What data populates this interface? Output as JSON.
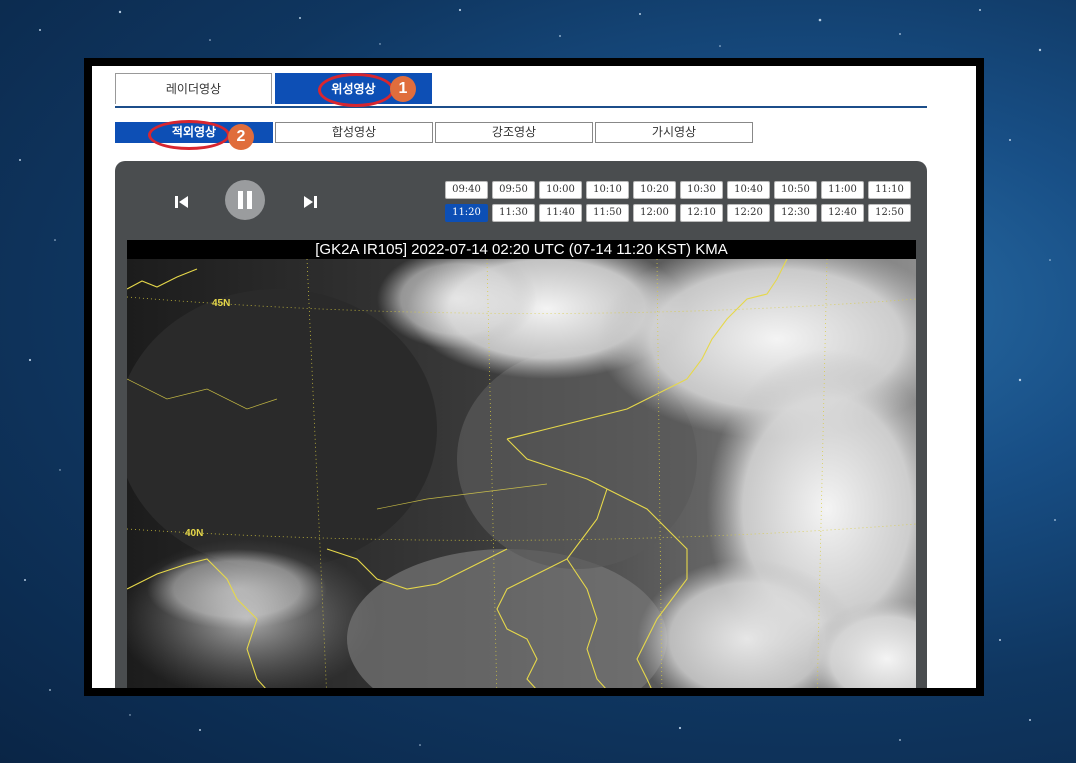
{
  "main_tabs": [
    {
      "label": "레이더영상",
      "active": false
    },
    {
      "label": "위성영상",
      "active": true
    }
  ],
  "sub_tabs": [
    {
      "label": "적외영상",
      "active": true
    },
    {
      "label": "합성영상",
      "active": false
    },
    {
      "label": "강조영상",
      "active": false
    },
    {
      "label": "가시영상",
      "active": false
    }
  ],
  "annotations": {
    "badge1": "1",
    "badge2": "2"
  },
  "player": {
    "prev_icon": "skip-back-icon",
    "pause_icon": "pause-icon",
    "next_icon": "skip-forward-icon",
    "times_row1": [
      "09:40",
      "09:50",
      "10:00",
      "10:10",
      "10:20",
      "10:30",
      "10:40",
      "10:50",
      "11:00",
      "11:10"
    ],
    "times_row2": [
      "11:20",
      "11:30",
      "11:40",
      "11:50",
      "12:00",
      "12:10",
      "12:20",
      "12:30",
      "12:40",
      "12:50"
    ],
    "selected_time": "11:20"
  },
  "image": {
    "title": "[GK2A IR105] 2022-07-14 02:20 UTC (07-14 11:20 KST) KMA",
    "lat_labels": [
      "45N",
      "40N"
    ]
  },
  "colors": {
    "accent": "#0d4fb5",
    "annotation": "#d8262f",
    "badge": "#e06d3c",
    "coastline": "#e6d84a"
  }
}
